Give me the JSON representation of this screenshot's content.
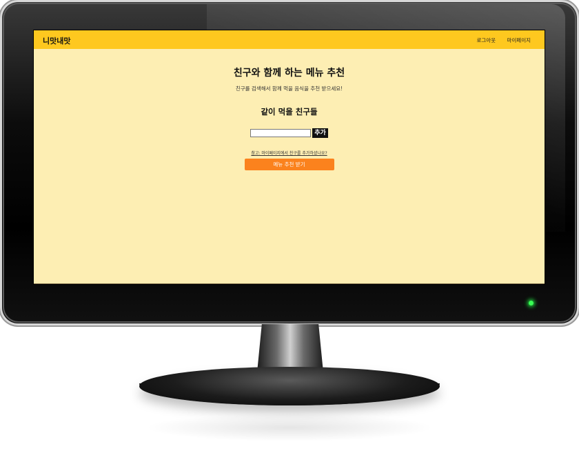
{
  "app": {
    "brand": "니맛내맛",
    "nav": {
      "logout": "로그아웃",
      "mypage": "마이페이지"
    }
  },
  "main": {
    "title": "친구와 함께 하는 메뉴 추천",
    "subtitle": "친구를 검색해서 함께 먹을 음식을 추천 받으세요!",
    "friends_heading": "같이 먹을 친구들",
    "friend_input": {
      "value": "",
      "placeholder": ""
    },
    "add_button": "추가",
    "hint_link": "참고: 마이페이지에서 친구를 추가하셨나요?",
    "recommend_button": "메뉴 추천 받기"
  },
  "colors": {
    "navbar": "#fec81f",
    "background": "#fdeeb3",
    "recommend_button": "#fb821d",
    "add_button": "#111111",
    "power_led": "#39ff55"
  },
  "icons": {
    "power_led": "power-led-icon"
  }
}
